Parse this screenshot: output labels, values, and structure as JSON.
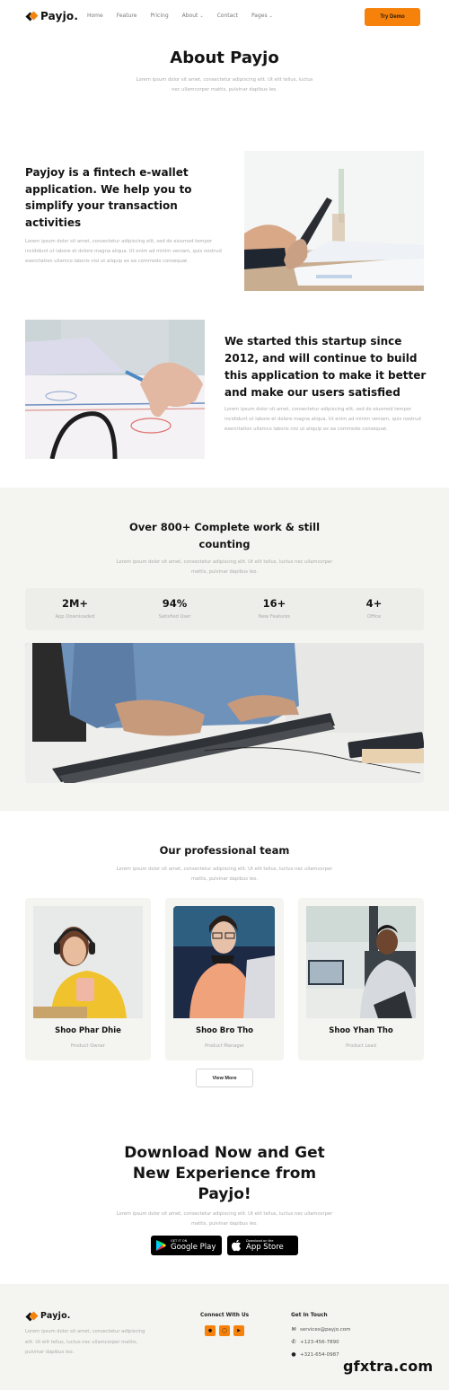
{
  "brand": {
    "name": "Payjo.",
    "accent": "#f6820c"
  },
  "nav": {
    "links": [
      {
        "label": "Home",
        "dropdown": false
      },
      {
        "label": "Feature",
        "dropdown": false
      },
      {
        "label": "Pricing",
        "dropdown": false
      },
      {
        "label": "About",
        "dropdown": true
      },
      {
        "label": "Contact",
        "dropdown": false
      },
      {
        "label": "Pages",
        "dropdown": true
      }
    ],
    "cta": "Try Demo"
  },
  "hero": {
    "title": "About Payjo",
    "subtitle": "Lorem ipsum dolor sit amet, consectetur adipiscing elit. Ut elit tellus, luctus nec ullamcorper mattis, pulvinar dapibus leo."
  },
  "about": [
    {
      "title": "Payjoy is a fintech e-wallet application. We help you to simplify your transaction activities",
      "text": "Lorem ipsum dolor sit amet, consectetur adipiscing elit, sed do eiusmod tempor incididunt ut labore et dolore magna aliqua. Ut enim ad minim veniam, quis nostrud exercitation ullamco laboris nisi ut aliquip ex ea commodo consequat.",
      "image": "hand-holding-phone-photo"
    },
    {
      "title": "We started this startup since 2012, and will continue to build this application to make it better and make our users satisfied",
      "text": "Lorem ipsum dolor sit amet, consectetur adipiscing elit, sed do eiusmod tempor incididunt ut labore et dolore magna aliqua. Ut enim ad minim veniam, quis nostrud exercitation ullamco laboris nisi ut aliquip ex ea commodo consequat.",
      "image": "hand-with-pencil-on-documents-photo"
    }
  ],
  "stats": {
    "title": "Over 800+ Complete work & still counting",
    "subtitle": "Lorem ipsum dolor sit amet, consectetur adipiscing elit. Ut elit tellus, luctus nec ullamcorper mattis, pulvinar dapibus leo.",
    "items": [
      {
        "value": "2M+",
        "label": "App Downloaded"
      },
      {
        "value": "94%",
        "label": "Satisfied User"
      },
      {
        "value": "16+",
        "label": "New Features"
      },
      {
        "value": "4+",
        "label": "Office"
      }
    ],
    "image": "hands-typing-on-keyboard-photo"
  },
  "team": {
    "title": "Our professional team",
    "subtitle": "Lorem ipsum dolor sit amet, consectetur adipiscing elit. Ut elit tellus, luctus nec ullamcorper mattis, pulvinar dapibus leo.",
    "members": [
      {
        "name": "Shoo Phar Dhie",
        "role": "Product Owner",
        "photo": "woman-yellow-headphones-photo"
      },
      {
        "name": "Shoo Bro Tho",
        "role": "Product Manager",
        "photo": "woman-glasses-laptop-photo"
      },
      {
        "name": "Shoo Yhan Tho",
        "role": "Product Lead",
        "photo": "man-office-chair-photo"
      }
    ],
    "view_more": "View More"
  },
  "download": {
    "title": "Download Now and Get New Experience from Payjo!",
    "subtitle": "Lorem ipsum dolor sit amet, consectetur adipiscing elit. Ut elit tellus, luctus nec ullamcorper mattis, pulvinar dapibus leo.",
    "google_play": {
      "small": "GET IT ON",
      "big": "Google Play"
    },
    "app_store": {
      "small": "Download on the",
      "big": "App Store"
    }
  },
  "footer": {
    "logo": "Payjo.",
    "text": "Lorem ipsum dolor sit amet, consectetur adipiscing elit. Ut elit tellus, luctus nec ullamcorper mattis, pulvinar dapibus leo.",
    "connect_heading": "Connect With Us",
    "social": [
      "facebook-icon",
      "instagram-icon",
      "youtube-icon"
    ],
    "contact_heading": "Get In Touch",
    "email": "services@payjo.com",
    "phone": "+123-456-7890",
    "whatsapp": "+321-654-0987"
  },
  "watermark": "gfxtra.com"
}
